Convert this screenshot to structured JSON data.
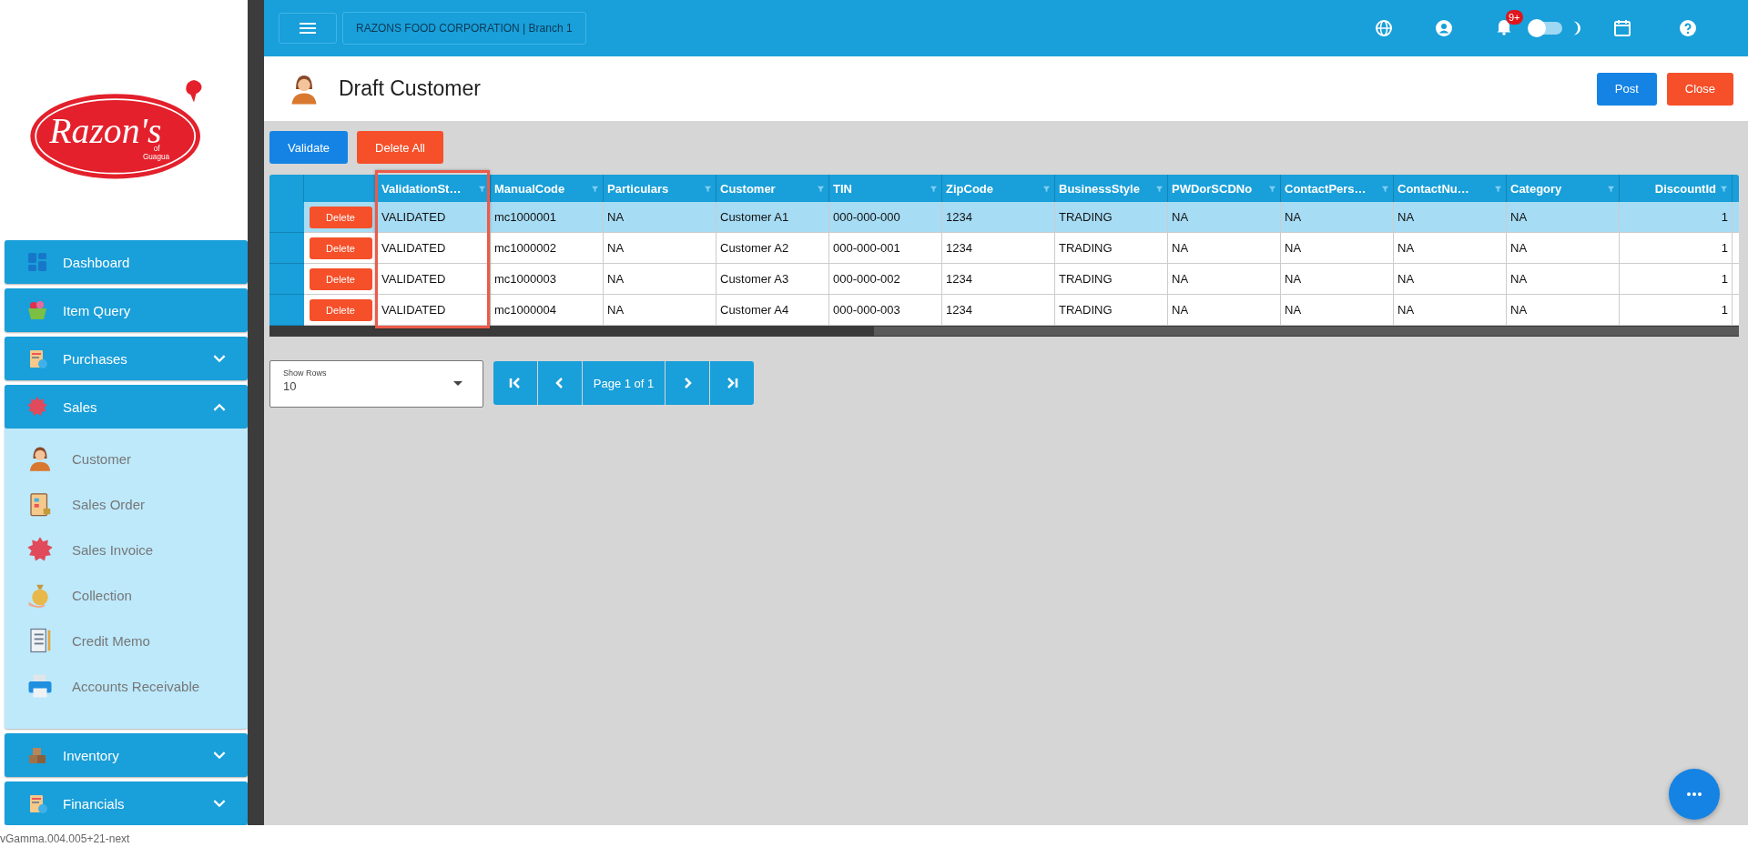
{
  "sidebar": {
    "logo": {
      "name": "Razon's",
      "of": "of",
      "place": "Guagua"
    },
    "items": [
      {
        "label": "Dashboard"
      },
      {
        "label": "Item Query"
      },
      {
        "label": "Purchases",
        "expanded": false
      },
      {
        "label": "Sales",
        "expanded": true,
        "children": [
          {
            "label": "Customer"
          },
          {
            "label": "Sales Order"
          },
          {
            "label": "Sales Invoice"
          },
          {
            "label": "Collection"
          },
          {
            "label": "Credit Memo"
          },
          {
            "label": "Accounts Receivable"
          }
        ]
      },
      {
        "label": "Inventory",
        "expanded": false
      },
      {
        "label": "Financials",
        "expanded": false
      }
    ],
    "version": "vGamma.004.005+21-next"
  },
  "topbar": {
    "company": "RAZONS FOOD CORPORATION | Branch 1",
    "notification_badge": "9+",
    "dark_mode": false
  },
  "page": {
    "title": "Draft Customer",
    "actions": [
      {
        "label": "Post",
        "kind": "primary"
      },
      {
        "label": "Close",
        "kind": "danger"
      }
    ]
  },
  "toolbar": [
    {
      "label": "Validate",
      "kind": "primary"
    },
    {
      "label": "Delete All",
      "kind": "danger"
    }
  ],
  "grid": {
    "columns": [
      {
        "label": "ValidationSt…",
        "highlighted": true,
        "kind": "text"
      },
      {
        "label": "ManualCode",
        "highlighted": false,
        "kind": "text"
      },
      {
        "label": "Particulars",
        "highlighted": false,
        "kind": "text"
      },
      {
        "label": "Customer",
        "highlighted": false,
        "kind": "text"
      },
      {
        "label": "TIN",
        "highlighted": false,
        "kind": "text"
      },
      {
        "label": "ZipCode",
        "highlighted": false,
        "kind": "text"
      },
      {
        "label": "BusinessStyle",
        "highlighted": false,
        "kind": "text"
      },
      {
        "label": "PWDorSCDNo",
        "highlighted": false,
        "kind": "text"
      },
      {
        "label": "ContactPers…",
        "highlighted": false,
        "kind": "text"
      },
      {
        "label": "ContactNu…",
        "highlighted": false,
        "kind": "text"
      },
      {
        "label": "Category",
        "highlighted": false,
        "kind": "text"
      },
      {
        "label": "DiscountId",
        "highlighted": false,
        "kind": "number"
      }
    ],
    "rows": [
      {
        "selected": true,
        "action": "Delete",
        "cells": [
          "VALIDATED",
          "mc1000001",
          "NA",
          "Customer A1",
          "000-000-000",
          "1234",
          "TRADING",
          "NA",
          "NA",
          "NA",
          "NA",
          "1"
        ]
      },
      {
        "selected": false,
        "action": "Delete",
        "cells": [
          "VALIDATED",
          "mc1000002",
          "NA",
          "Customer A2",
          "000-000-001",
          "1234",
          "TRADING",
          "NA",
          "NA",
          "NA",
          "NA",
          "1"
        ]
      },
      {
        "selected": false,
        "action": "Delete",
        "cells": [
          "VALIDATED",
          "mc1000003",
          "NA",
          "Customer A3",
          "000-000-002",
          "1234",
          "TRADING",
          "NA",
          "NA",
          "NA",
          "NA",
          "1"
        ]
      },
      {
        "selected": false,
        "action": "Delete",
        "cells": [
          "VALIDATED",
          "mc1000004",
          "NA",
          "Customer A4",
          "000-000-003",
          "1234",
          "TRADING",
          "NA",
          "NA",
          "NA",
          "NA",
          "1"
        ]
      }
    ]
  },
  "pager": {
    "show_rows_label": "Show Rows",
    "show_rows_value": "10",
    "page_label": "Page 1 of 1"
  }
}
